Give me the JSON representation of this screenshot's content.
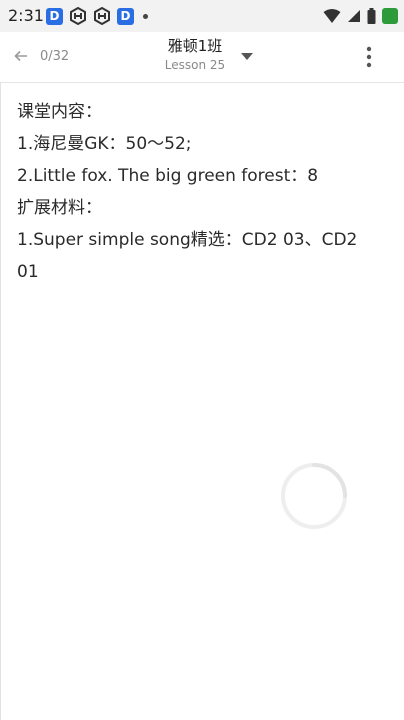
{
  "status_bar": {
    "time": "2:31",
    "left_icons": [
      "d-app-icon",
      "sync-hex-icon",
      "sync-hex-icon",
      "d-app-icon",
      "notification-dot-icon"
    ],
    "right_icons": [
      "wifi-icon",
      "signal-icon",
      "battery-icon",
      "green-app-icon"
    ],
    "badge_letter": "D"
  },
  "app_bar": {
    "page_counter": "0/32",
    "class_title": "雅顿1班",
    "lesson_subtitle": "Lesson 25"
  },
  "content": {
    "lines": [
      "课堂内容：",
      "1.海尼曼GK：50～52;",
      "2.Little fox. The big green forest：8",
      "扩展材料：",
      "1.Super simple song精选：CD2 03、CD2",
      "01"
    ]
  },
  "colors": {
    "status_bar_bg": "#f2f2f2",
    "app_badge_blue": "#2b6de3",
    "app_badge_green": "#2e9b3a",
    "text_primary": "#2a2a2a",
    "text_secondary": "#8a8a8a"
  }
}
